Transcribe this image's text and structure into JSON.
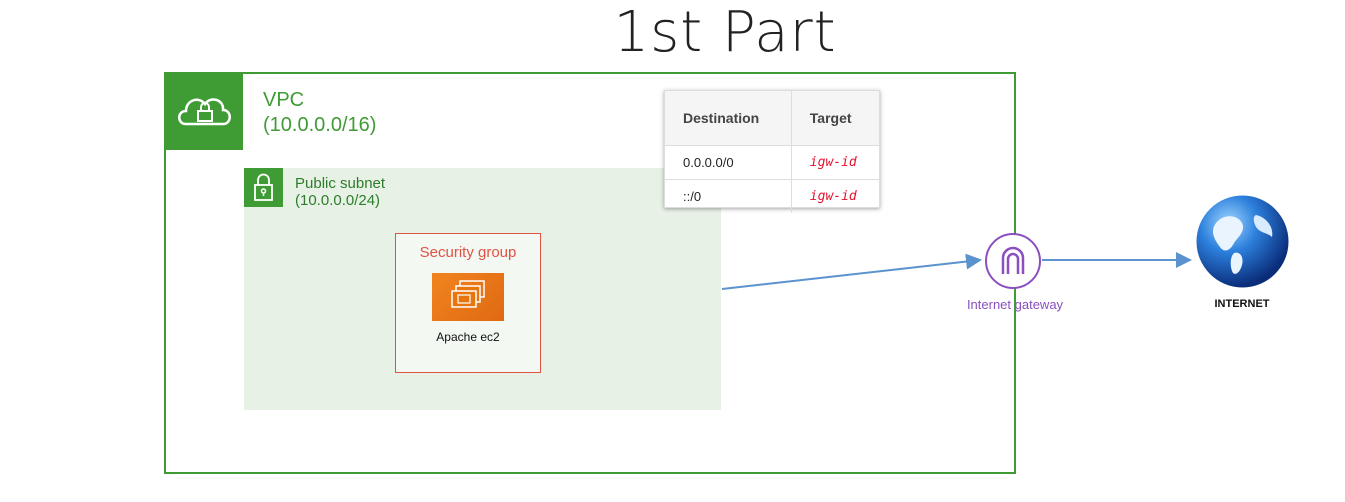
{
  "title": "1st Part",
  "vpc": {
    "name": "VPC",
    "cidr": "(10.0.0.0/16)",
    "icon": "cloud-lock-icon"
  },
  "subnet": {
    "name": "Public subnet",
    "cidr": "(10.0.0.0/24)",
    "icon": "lock-icon"
  },
  "security_group": {
    "name": "Security group",
    "instance_label": "Apache ec2",
    "instance_icon": "ec2-instance-icon"
  },
  "route_table": {
    "headers": [
      "Destination",
      "Target"
    ],
    "rows": [
      {
        "destination": "0.0.0.0/0",
        "target": "igw-id"
      },
      {
        "destination": "::/0",
        "target": "igw-id"
      }
    ]
  },
  "internet_gateway": {
    "label": "Internet gateway",
    "icon": "internet-gateway-icon"
  },
  "internet": {
    "label": "INTERNET",
    "icon": "globe-icon"
  },
  "colors": {
    "vpc_green": "#3f9c35",
    "subnet_fill": "#e7f1e6",
    "security_group_red": "#e05243",
    "ec2_orange": "#e8760f",
    "gateway_purple": "#8c4fbf",
    "arrow_blue": "#5b93cf",
    "target_red": "#e3112c"
  }
}
